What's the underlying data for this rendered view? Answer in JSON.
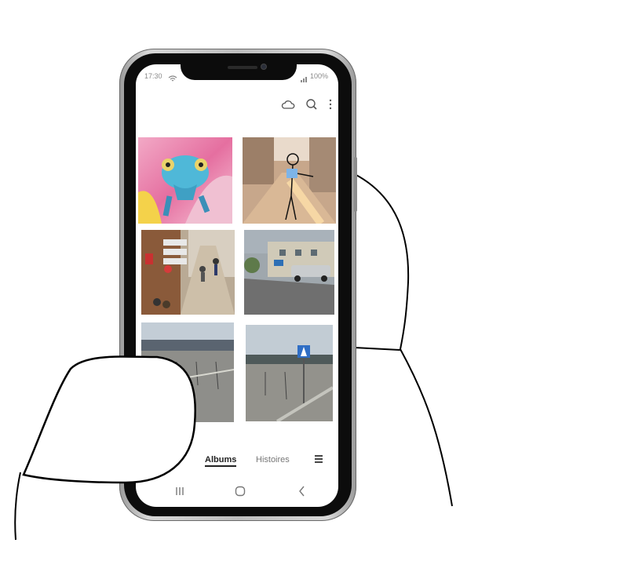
{
  "status": {
    "time": "17:30",
    "battery": "100%"
  },
  "toolbar": {
    "cloud_icon": "cloud-icon",
    "search_icon": "search-icon",
    "more_icon": "more-vertical-icon"
  },
  "photos": [
    {
      "subject": "chameleon-photo"
    },
    {
      "subject": "street-sketch-photo"
    },
    {
      "subject": "signpost-crowd-photo"
    },
    {
      "subject": "street-parking-photo"
    },
    {
      "subject": "parking-lot-photo"
    },
    {
      "subject": "parking-crosswalk-photo"
    }
  ],
  "tabs": {
    "albums": "Albums",
    "stories": "Histoires"
  },
  "colors": {
    "accent": "#222222",
    "frame": "#0c0c0c"
  }
}
